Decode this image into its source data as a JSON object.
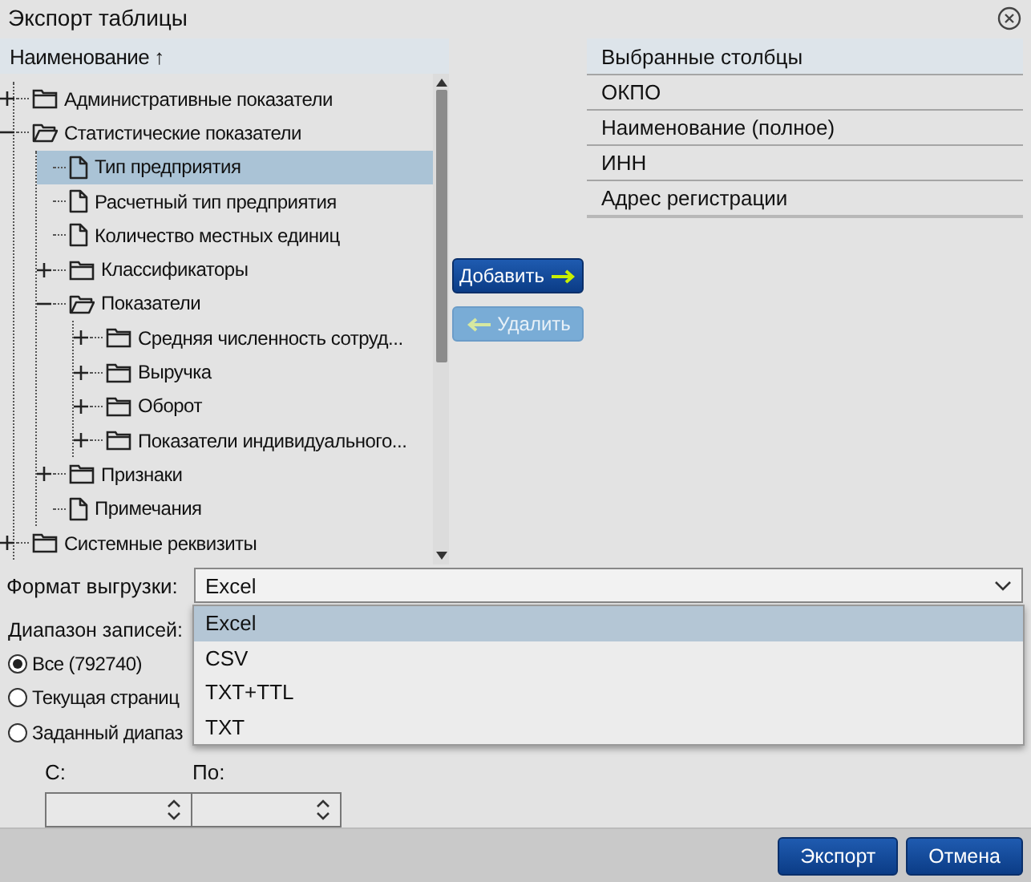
{
  "window": {
    "title": "Экспорт таблицы"
  },
  "tree": {
    "header": "Наименование",
    "sort_arrow": "↑",
    "items": [
      {
        "label": "Административные показатели",
        "kind": "folder",
        "expanded": false,
        "selected": false
      },
      {
        "label": "Статистические показатели",
        "kind": "folder",
        "expanded": true,
        "selected": false,
        "children": [
          {
            "label": "Тип предприятия",
            "kind": "document",
            "selected": true
          },
          {
            "label": "Расчетный тип предприятия",
            "kind": "document",
            "selected": false
          },
          {
            "label": "Количество местных единиц",
            "kind": "document",
            "selected": false
          },
          {
            "label": "Классификаторы",
            "kind": "folder",
            "expanded": false,
            "selected": false
          },
          {
            "label": "Показатели",
            "kind": "folder",
            "expanded": true,
            "selected": false,
            "children": [
              {
                "label": "Средняя численность сотруд...",
                "kind": "folder",
                "expanded": false,
                "selected": false
              },
              {
                "label": "Выручка",
                "kind": "folder",
                "expanded": false,
                "selected": false
              },
              {
                "label": "Оборот",
                "kind": "folder",
                "expanded": false,
                "selected": false
              },
              {
                "label": "Показатели индивидуального...",
                "kind": "folder",
                "expanded": false,
                "selected": false
              }
            ]
          },
          {
            "label": "Признаки",
            "kind": "folder",
            "expanded": false,
            "selected": false
          },
          {
            "label": "Примечания",
            "kind": "document",
            "selected": false
          }
        ]
      },
      {
        "label": "Системные реквизиты",
        "kind": "folder",
        "expanded": false,
        "selected": false
      }
    ]
  },
  "actions": [
    {
      "label": "Добавить",
      "kind": "add",
      "disabled": false
    },
    {
      "label": "Удалить",
      "kind": "remove",
      "disabled": true
    }
  ],
  "selected_columns": {
    "header": "Выбранные столбцы",
    "items": [
      "ОКПО",
      "Наименование (полное)",
      "ИНН",
      "Адрес регистрации"
    ]
  },
  "format": {
    "label": "Формат выгрузки:",
    "value": "Excel",
    "options": [
      {
        "label": "Excel",
        "selected": true
      },
      {
        "label": "CSV",
        "selected": false
      },
      {
        "label": "TXT+TTL",
        "selected": false
      },
      {
        "label": "TXT",
        "selected": false
      }
    ]
  },
  "range": {
    "label": "Диапазон записей:",
    "options": [
      {
        "label": "Все (792740)",
        "selected": true
      },
      {
        "label": "Текущая страниц",
        "selected": false
      },
      {
        "label": "Заданный диапаз",
        "selected": false
      }
    ],
    "from_label": "С:",
    "to_label": "По:"
  },
  "buttons": [
    {
      "label": "Экспорт"
    },
    {
      "label": "Отмена"
    }
  ]
}
